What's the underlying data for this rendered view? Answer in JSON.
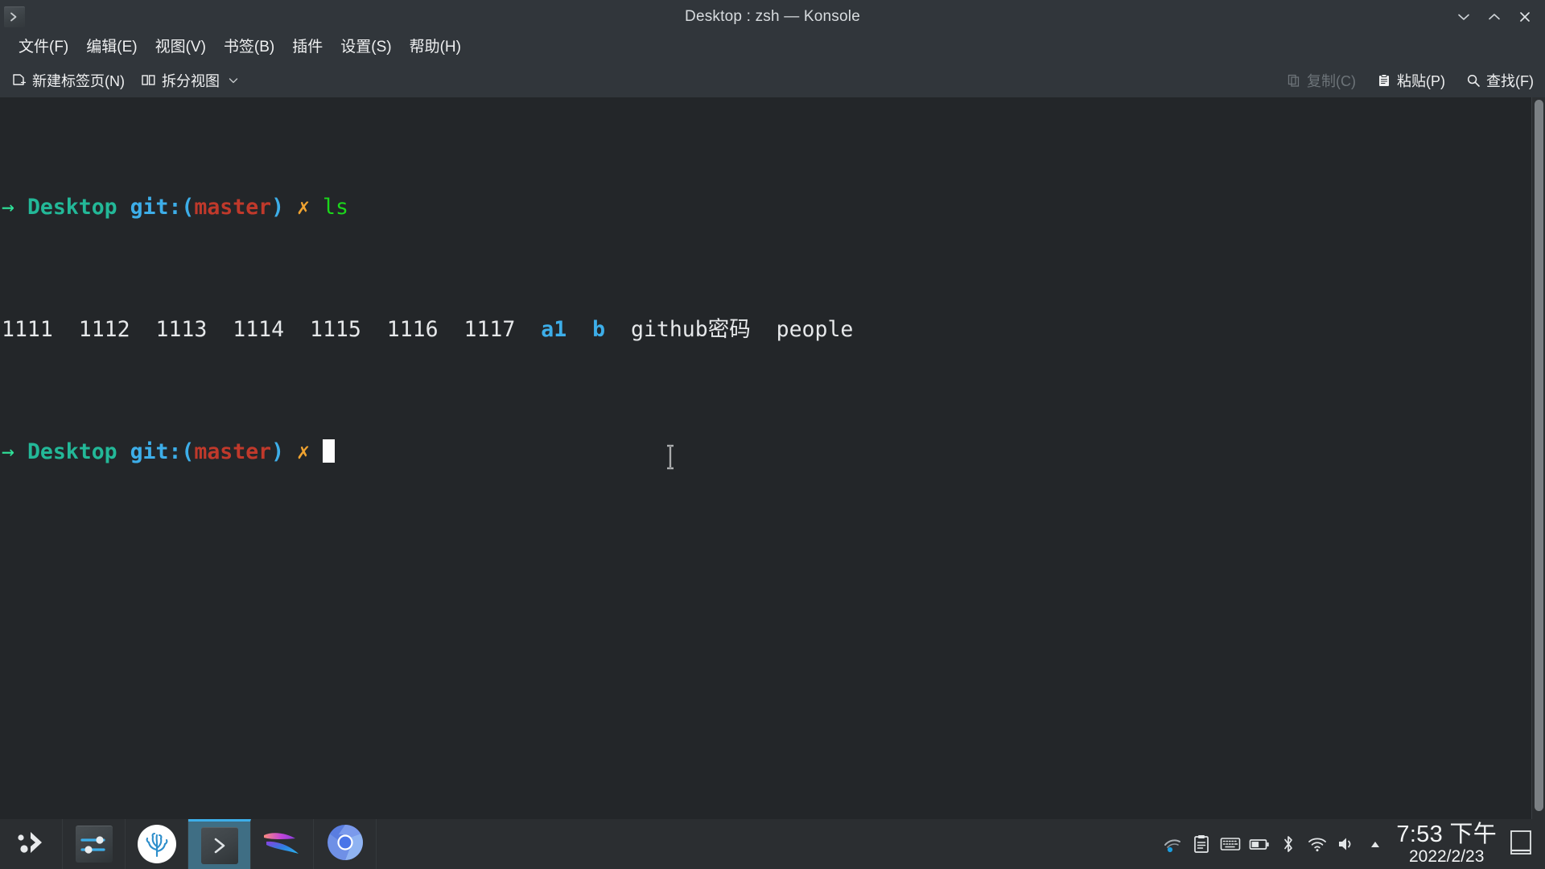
{
  "window": {
    "title": "Desktop : zsh — Konsole",
    "app_icon": "konsole-icon",
    "controls": [
      {
        "name": "minimize-button",
        "icon": "chevron-down-icon"
      },
      {
        "name": "maximize-button",
        "icon": "chevron-up-icon"
      },
      {
        "name": "close-button",
        "icon": "close-icon"
      }
    ]
  },
  "menubar": {
    "items": [
      {
        "label": "文件(F)",
        "name": "menu-file"
      },
      {
        "label": "编辑(E)",
        "name": "menu-edit"
      },
      {
        "label": "视图(V)",
        "name": "menu-view"
      },
      {
        "label": "书签(B)",
        "name": "menu-bookmarks"
      },
      {
        "label": "插件",
        "name": "menu-plugins"
      },
      {
        "label": "设置(S)",
        "name": "menu-settings"
      },
      {
        "label": "帮助(H)",
        "name": "menu-help"
      }
    ]
  },
  "toolbar": {
    "new_tab_label": "新建标签页(N)",
    "split_view_label": "拆分视图",
    "copy_label": "复制(C)",
    "copy_disabled": true,
    "paste_label": "粘贴(P)",
    "find_label": "查找(F)"
  },
  "terminal": {
    "background": "#232629",
    "lines": [
      {
        "type": "prompt",
        "arrow": "→",
        "dir": "Desktop",
        "git_label": "git:(",
        "branch": "master",
        "git_close": ")",
        "status": "✗",
        "command": "ls"
      },
      {
        "type": "output",
        "entries": [
          {
            "text": "1111",
            "color": "white"
          },
          {
            "text": "1112",
            "color": "white"
          },
          {
            "text": "1113",
            "color": "white"
          },
          {
            "text": "1114",
            "color": "white"
          },
          {
            "text": "1115",
            "color": "white"
          },
          {
            "text": "1116",
            "color": "white"
          },
          {
            "text": "1117",
            "color": "white"
          },
          {
            "text": "a1",
            "color": "blue"
          },
          {
            "text": "b",
            "color": "blue"
          },
          {
            "text": "github密码",
            "color": "white"
          },
          {
            "text": "people",
            "color": "white"
          }
        ]
      },
      {
        "type": "prompt",
        "arrow": "→",
        "dir": "Desktop",
        "git_label": "git:(",
        "branch": "master",
        "git_close": ")",
        "status": "✗",
        "command": ""
      }
    ],
    "colors": {
      "arrow": "#2fe39a",
      "dir": "#23b898",
      "git": "#3daee9",
      "branch": "#c0392b",
      "status": "#f0a330",
      "command": "#1bd71b",
      "file": "#e6e8ea",
      "directory": "#3daee9"
    }
  },
  "taskbar": {
    "launchers": [
      {
        "name": "application-menu-launcher",
        "icon": "kde-menu-icon"
      },
      {
        "name": "settings-launcher",
        "icon": "sliders-icon"
      },
      {
        "name": "file-manager-launcher",
        "icon": "coral-icon"
      },
      {
        "name": "konsole-task",
        "icon": "konsole-icon",
        "active": true
      },
      {
        "name": "media-launcher",
        "icon": "swoosh-icon"
      },
      {
        "name": "chromium-launcher",
        "icon": "chromium-icon"
      }
    ],
    "tray": [
      {
        "name": "tray-network-icon",
        "icon": "network-icon"
      },
      {
        "name": "tray-clipboard-icon",
        "icon": "clipboard-icon"
      },
      {
        "name": "tray-keyboard-icon",
        "icon": "keyboard-icon"
      },
      {
        "name": "tray-battery-icon",
        "icon": "battery-icon"
      },
      {
        "name": "tray-bluetooth-icon",
        "icon": "bluetooth-icon"
      },
      {
        "name": "tray-wifi-icon",
        "icon": "wifi-icon"
      },
      {
        "name": "tray-volume-icon",
        "icon": "volume-icon"
      },
      {
        "name": "tray-expand-icon",
        "icon": "triangle-up-icon"
      }
    ],
    "clock": {
      "time": "7:53 下午",
      "date": "2022/2/23"
    },
    "peek": {
      "name": "show-desktop-button",
      "icon": "desktop-icon"
    }
  }
}
